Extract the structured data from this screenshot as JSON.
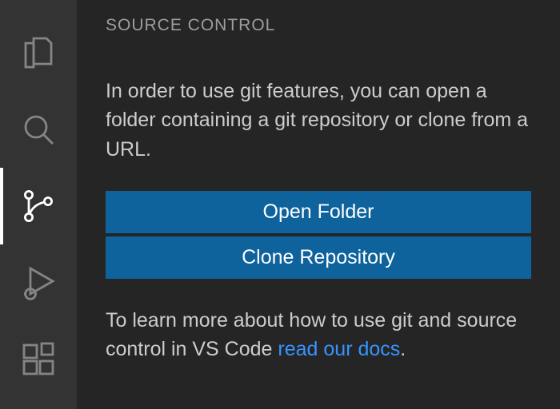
{
  "activityBar": {
    "items": [
      {
        "name": "explorer-icon"
      },
      {
        "name": "search-icon"
      },
      {
        "name": "source-control-icon",
        "active": true
      },
      {
        "name": "run-and-debug-icon"
      },
      {
        "name": "extensions-icon"
      }
    ]
  },
  "panel": {
    "title": "SOURCE CONTROL",
    "intro": "In order to use git features, you can open a folder containing a git repository or clone from a URL.",
    "buttons": {
      "openFolder": "Open Folder",
      "cloneRepository": "Clone Repository"
    },
    "learnPrefix": "To learn more about how to use git and source control in VS Code ",
    "learnLink": "read our docs",
    "learnSuffix": "."
  }
}
